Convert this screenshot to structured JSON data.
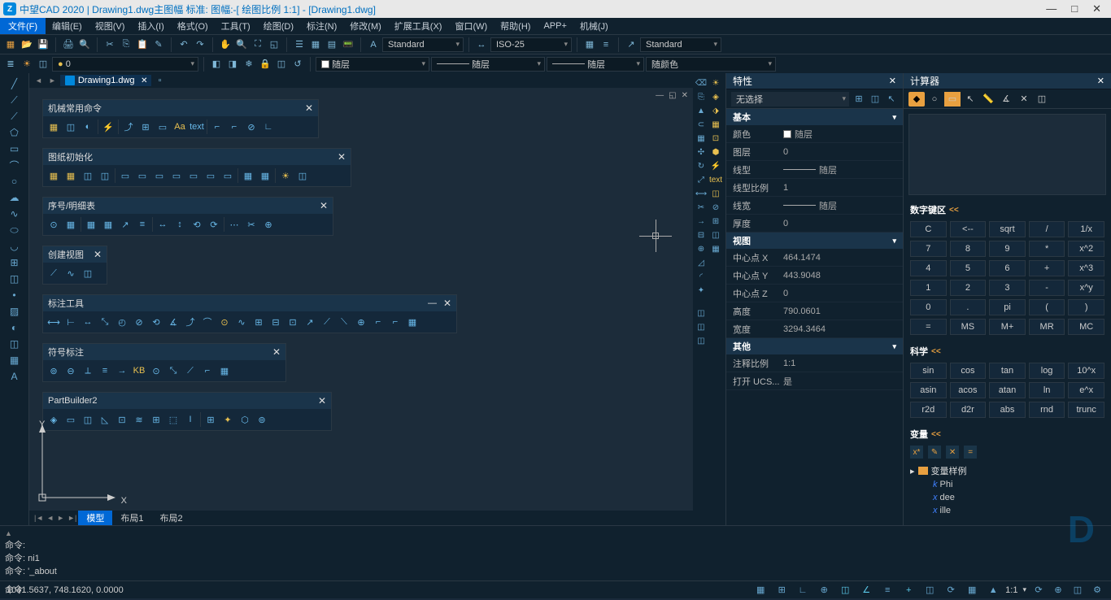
{
  "title": "中望CAD 2020 | Drawing1.dwg主图幅  标准: 图幅:-[ 绘图比例 1:1] - [Drawing1.dwg]",
  "menu": {
    "file": "文件(F)",
    "items": [
      "编辑(E)",
      "视图(V)",
      "插入(I)",
      "格式(O)",
      "工具(T)",
      "绘图(D)",
      "标注(N)",
      "修改(M)",
      "扩展工具(X)",
      "窗口(W)",
      "帮助(H)",
      "APP+",
      "机械(J)"
    ]
  },
  "toolbars": {
    "style1": "Standard",
    "style2": "ISO-25",
    "style3": "Standard",
    "layerdd": "0",
    "followLayer": "随层",
    "followColor": "随颜色"
  },
  "doc_tab": "Drawing1.dwg",
  "float_panels": {
    "p1": "机械常用命令",
    "p2": "图纸初始化",
    "p3": "序号/明细表",
    "p4": "创建视图",
    "p5": "标注工具",
    "p6": "符号标注",
    "p7": "PartBuilder2"
  },
  "bottom_tabs": {
    "model": "模型",
    "layout1": "布局1",
    "layout2": "布局2"
  },
  "properties": {
    "title": "特性",
    "selection": "无选择",
    "sections": {
      "basic": "基本",
      "view": "视图",
      "other": "其他"
    },
    "rows": {
      "color": {
        "label": "颜色",
        "value": "随层"
      },
      "layer": {
        "label": "图层",
        "value": "0"
      },
      "linetype": {
        "label": "线型",
        "value": "随层"
      },
      "ltscale": {
        "label": "线型比例",
        "value": "1"
      },
      "lineweight": {
        "label": "线宽",
        "value": "随层"
      },
      "thickness": {
        "label": "厚度",
        "value": "0"
      },
      "centerX": {
        "label": "中心点 X",
        "value": "464.1474"
      },
      "centerY": {
        "label": "中心点 Y",
        "value": "443.9048"
      },
      "centerZ": {
        "label": "中心点 Z",
        "value": "0"
      },
      "height": {
        "label": "高度",
        "value": "790.0601"
      },
      "width": {
        "label": "宽度",
        "value": "3294.3464"
      },
      "annoScale": {
        "label": "注释比例",
        "value": "1:1"
      },
      "ucs": {
        "label": "打开 UCS...",
        "value": "是"
      }
    }
  },
  "calculator": {
    "title": "计算器",
    "sections": {
      "numpad": "数字键区",
      "sci": "科学",
      "vars": "变量"
    },
    "keys_num": [
      "C",
      "<--",
      "sqrt",
      "/",
      "1/x",
      "7",
      "8",
      "9",
      "*",
      "x^2",
      "4",
      "5",
      "6",
      "+",
      "x^3",
      "1",
      "2",
      "3",
      "-",
      "x^y",
      "0",
      ".",
      "pi",
      "(",
      ")",
      "=",
      "MS",
      "M+",
      "MR",
      "MC"
    ],
    "keys_sci": [
      "sin",
      "cos",
      "tan",
      "log",
      "10^x",
      "asin",
      "acos",
      "atan",
      "ln",
      "e^x",
      "r2d",
      "d2r",
      "abs",
      "rnd",
      "trunc"
    ],
    "var_folder": "变量样例",
    "vars_list": [
      {
        "sym": "k",
        "name": "Phi"
      },
      {
        "sym": "x",
        "name": "dee"
      },
      {
        "sym": "x",
        "name": "ille"
      }
    ]
  },
  "cmdline": {
    "l1": "命令:",
    "l2": "命令: ni1",
    "l3": "命令: '_about",
    "prompt": "命令:"
  },
  "statusbar": {
    "coords": "1041.5637, 748.1620, 0.0000",
    "scale": "1:1"
  },
  "axes": {
    "x": "X",
    "y": "Y"
  }
}
